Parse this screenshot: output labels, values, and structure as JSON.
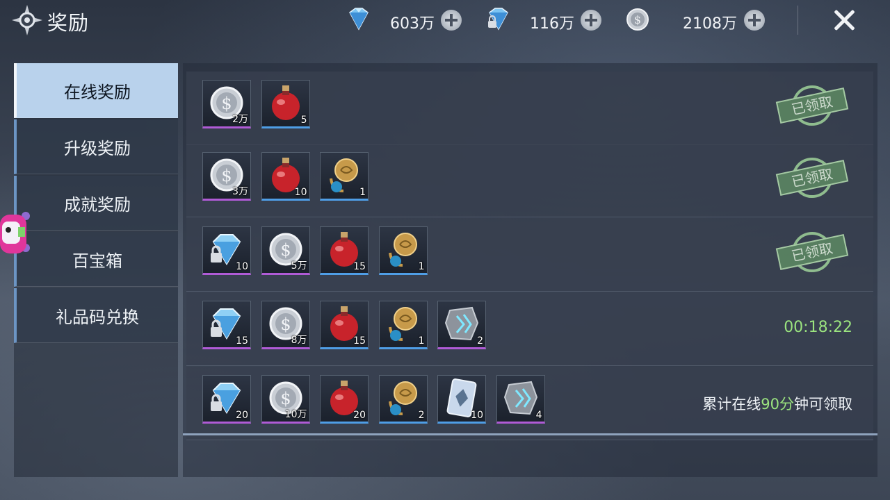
{
  "header": {
    "title": "奖励",
    "close_icon": "close-icon",
    "resources": [
      {
        "icon": "diamond-icon",
        "value": "603万"
      },
      {
        "icon": "locked-diamond-icon",
        "value": "116万"
      },
      {
        "icon": "silver-coin-icon",
        "value": "2108万"
      }
    ]
  },
  "sidebar": {
    "tabs": [
      {
        "label": "在线奖励",
        "active": true
      },
      {
        "label": "升级奖励",
        "active": false
      },
      {
        "label": "成就奖励",
        "active": false
      },
      {
        "label": "百宝箱",
        "active": false
      },
      {
        "label": "礼品码兑换",
        "active": false
      }
    ]
  },
  "rewards": [
    {
      "items": [
        {
          "icon": "silver-coin",
          "qty": "2万",
          "rarity": "purple"
        },
        {
          "icon": "red-potion",
          "qty": "5",
          "rarity": "blue"
        }
      ],
      "status": "claimed",
      "stamp_text": "已领取"
    },
    {
      "items": [
        {
          "icon": "silver-coin",
          "qty": "3万",
          "rarity": "purple"
        },
        {
          "icon": "red-potion",
          "qty": "10",
          "rarity": "blue"
        },
        {
          "icon": "ring",
          "qty": "1",
          "rarity": "blue"
        }
      ],
      "status": "claimed",
      "stamp_text": "已领取"
    },
    {
      "items": [
        {
          "icon": "locked-diamond",
          "qty": "10",
          "rarity": "purple"
        },
        {
          "icon": "silver-coin",
          "qty": "5万",
          "rarity": "purple"
        },
        {
          "icon": "red-potion",
          "qty": "15",
          "rarity": "blue"
        },
        {
          "icon": "ring",
          "qty": "1",
          "rarity": "blue"
        }
      ],
      "status": "claimed",
      "stamp_text": "已领取"
    },
    {
      "items": [
        {
          "icon": "locked-diamond",
          "qty": "15",
          "rarity": "purple"
        },
        {
          "icon": "silver-coin",
          "qty": "8万",
          "rarity": "purple"
        },
        {
          "icon": "red-potion",
          "qty": "15",
          "rarity": "blue"
        },
        {
          "icon": "ring",
          "qty": "1",
          "rarity": "blue"
        },
        {
          "icon": "stone",
          "qty": "2",
          "rarity": "purple"
        }
      ],
      "status": "timer",
      "timer": "00:18:22"
    },
    {
      "items": [
        {
          "icon": "locked-diamond",
          "qty": "20",
          "rarity": "purple"
        },
        {
          "icon": "silver-coin",
          "qty": "10万",
          "rarity": "purple"
        },
        {
          "icon": "red-potion",
          "qty": "20",
          "rarity": "blue"
        },
        {
          "icon": "ring",
          "qty": "2",
          "rarity": "blue"
        },
        {
          "icon": "card",
          "qty": "10",
          "rarity": "blue"
        },
        {
          "icon": "stone",
          "qty": "4",
          "rarity": "purple"
        }
      ],
      "status": "hint",
      "hint_prefix": "累计在线",
      "hint_highlight": "90分",
      "hint_suffix": "钟可领取"
    }
  ]
}
